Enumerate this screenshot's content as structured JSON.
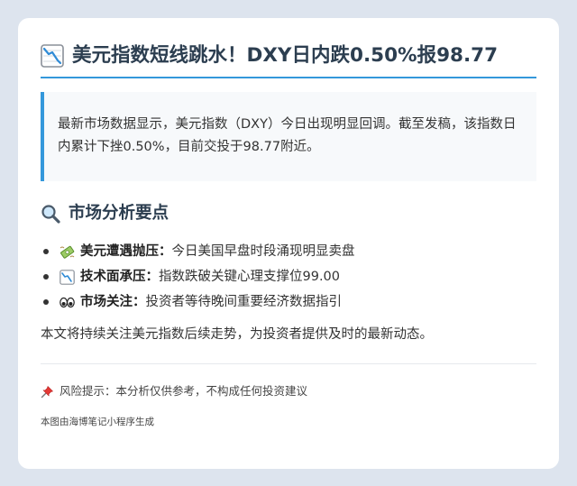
{
  "article": {
    "title_icon": "chart-decreasing-icon",
    "title": "美元指数短线跳水！DXY日内跌0.50%报98.77",
    "summary": "最新市场数据显示，美元指数（DXY）今日出现明显回调。截至发稿，该指数日内累计下挫0.50%，目前交投于98.77附近。",
    "analysis": {
      "icon": "magnifier-icon",
      "heading": "市场分析要点",
      "points": [
        {
          "icon": "money-with-wings-icon",
          "label": "美元遭遇抛压：",
          "text": "今日美国早盘时段涌现明显卖盘"
        },
        {
          "icon": "chart-decreasing-icon",
          "label": "技术面承压：",
          "text": "指数跌破关键心理支撑位99.00"
        },
        {
          "icon": "eyes-icon",
          "label": "市场关注：",
          "text": "投资者等待晚间重要经济数据指引"
        }
      ]
    },
    "closing": "本文将持续关注美元指数后续走势，为投资者提供及时的最新动态。",
    "risk": {
      "icon": "pushpin-icon",
      "text": "风险提示：本分析仅供参考，不构成任何投资建议"
    },
    "footer": "本图由海博笔记小程序生成"
  }
}
